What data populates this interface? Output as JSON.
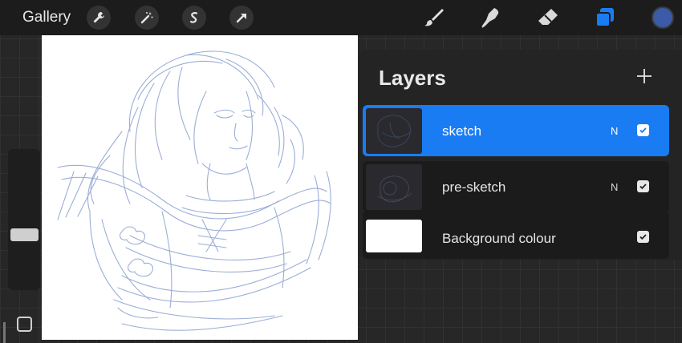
{
  "toolbar": {
    "gallery_label": "Gallery",
    "left_tools": [
      "wrench-icon",
      "magic-wand-icon",
      "selection-icon",
      "transform-arrow-icon"
    ],
    "right_tools": [
      "brush-icon",
      "smudge-icon",
      "eraser-icon",
      "layers-icon"
    ],
    "active_tool": "layers-icon",
    "current_color": "#3b5aa8"
  },
  "layers_panel": {
    "title": "Layers",
    "add_icon": "plus-icon",
    "layers": [
      {
        "name": "sketch",
        "blend_mode": "N",
        "visible": true,
        "selected": true
      },
      {
        "name": "pre-sketch",
        "blend_mode": "N",
        "visible": true,
        "selected": false
      },
      {
        "name": "Background colour",
        "blend_mode": "",
        "visible": true,
        "selected": false
      }
    ]
  },
  "colors": {
    "accent": "#1a7cf3",
    "sketch_stroke": "#7f97cc"
  }
}
